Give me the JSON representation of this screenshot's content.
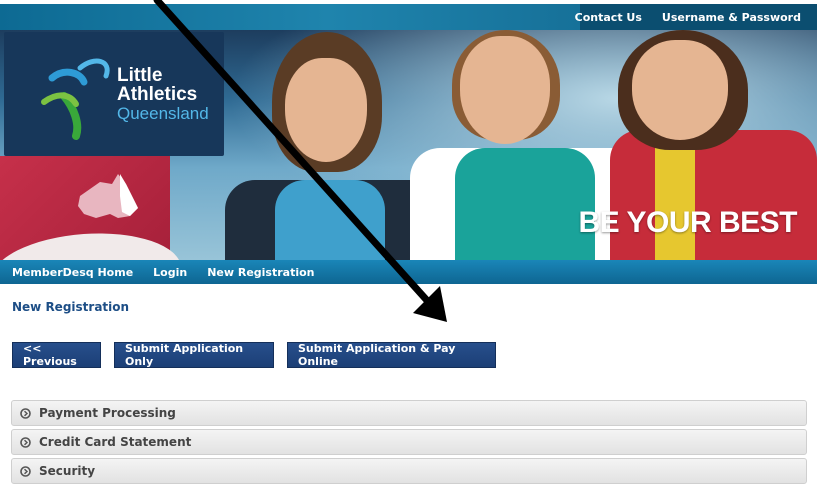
{
  "topbar": {
    "contact_label": "Contact Us",
    "credentials_label": "Username & Password"
  },
  "banner": {
    "logo_line1": "Little",
    "logo_line2": "Athletics",
    "logo_line3": "Queensland",
    "tagline": "BE YOUR BEST"
  },
  "nav": {
    "items": [
      {
        "label": "MemberDesq Home"
      },
      {
        "label": "Login"
      },
      {
        "label": "New Registration"
      }
    ]
  },
  "main": {
    "title": "New Registration",
    "buttons": {
      "previous": "<< Previous",
      "submit_only": "Submit Application Only",
      "submit_pay": "Submit Application & Pay Online"
    },
    "panels": [
      {
        "label": "Payment Processing"
      },
      {
        "label": "Credit Card Statement"
      },
      {
        "label": "Security"
      }
    ]
  },
  "colors": {
    "nav_blue": "#0e6692",
    "button_navy": "#1c3f76",
    "logo_navy": "#17375a",
    "accent_light_blue": "#53b7e8"
  }
}
